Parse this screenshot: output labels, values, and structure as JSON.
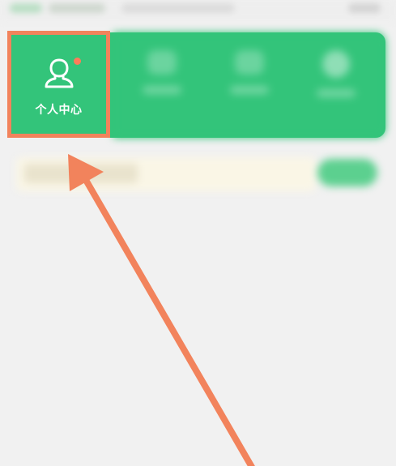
{
  "profile_tile": {
    "label": "个人中心",
    "icon": "user-icon",
    "has_notification": true
  },
  "colors": {
    "brand_green": "#33c47a",
    "annotation_orange": "#f2835c",
    "notification_dot": "#ff7b5a",
    "background": "#f1f1f1"
  }
}
